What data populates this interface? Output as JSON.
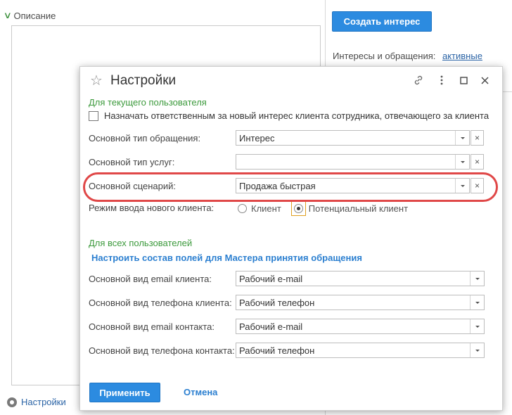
{
  "background": {
    "description_header": "Описание",
    "bottom_settings": "Настройки",
    "create_interest_button": "Создать интерес",
    "interests_label": "Интересы и обращения:",
    "interests_link": "активные"
  },
  "dialog": {
    "title": "Настройки",
    "current_user_section": "Для текущего пользователя",
    "assign_responsible_label": "Назначать ответственным за новый интерес клиента сотрудника, отвечающего за клиента",
    "assign_responsible_checked": false,
    "main_request_type": {
      "label": "Основной тип обращения:",
      "value": "Интерес"
    },
    "main_service_type": {
      "label": "Основной тип услуг:",
      "value": ""
    },
    "main_scenario": {
      "label": "Основной сценарий:",
      "value": "Продажа быстрая"
    },
    "new_client_mode": {
      "label": "Режим ввода нового клиента:",
      "options": [
        "Клиент",
        "Потенциальный клиент"
      ],
      "selected": "Потенциальный клиент"
    },
    "all_users_section": "Для всех пользователей",
    "configure_fields_link": "Настроить состав полей для Мастера принятия обращения",
    "email_client": {
      "label": "Основной вид email клиента:",
      "value": "Рабочий e-mail"
    },
    "phone_client": {
      "label": "Основной вид телефона клиента:",
      "value": "Рабочий телефон"
    },
    "email_contact": {
      "label": "Основной вид email контакта:",
      "value": "Рабочий e-mail"
    },
    "phone_contact": {
      "label": "Основной вид телефона контакта:",
      "value": "Рабочий телефон"
    },
    "apply_button": "Применить",
    "cancel_button": "Отмена",
    "clear_symbol": "×"
  },
  "icons": {
    "star": "star-icon",
    "link": "link-icon",
    "more": "more-vertical-icon",
    "maximize": "maximize-icon",
    "close": "close-icon"
  },
  "colors": {
    "accent_button": "#2c8be0",
    "section_green": "#3c9a3c",
    "link_blue": "#2b7fd0",
    "highlight_red": "#e04848"
  }
}
